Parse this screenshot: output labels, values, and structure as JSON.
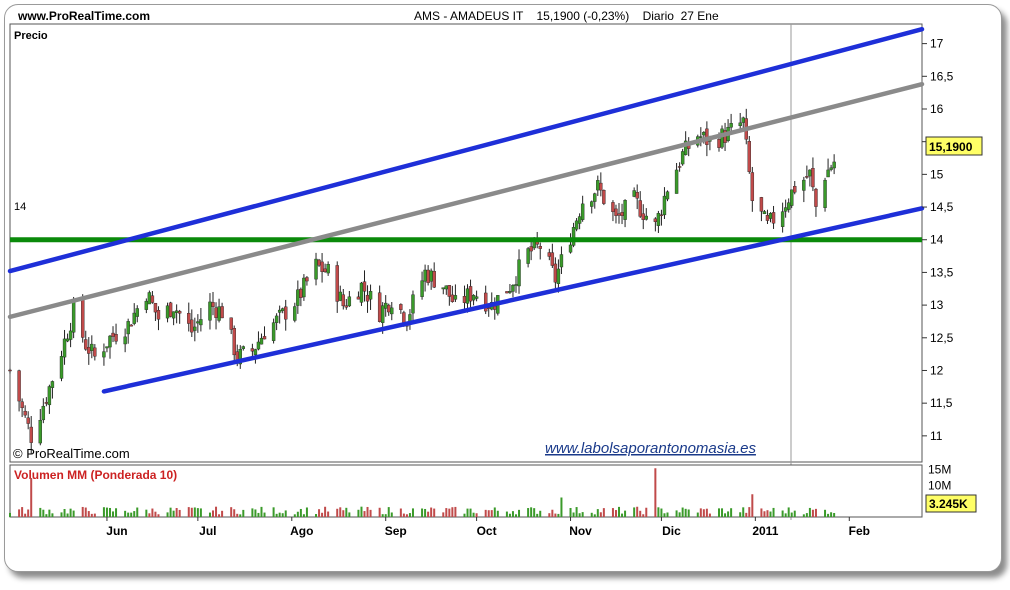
{
  "header": {
    "site": "www.ProRealTime.com",
    "symbol": "AMS - AMADEUS IT",
    "price": "15,1900 (-0,23%)",
    "period": "Diario",
    "date": "27 Ene"
  },
  "colors": {
    "up": "#3a9a2a",
    "down": "#c04a4a",
    "channel": "#1e2fd8",
    "mid_line": "#8a8a8a",
    "support": "#0a8a0a",
    "price_tag": "#ffff66"
  },
  "chart_data": [
    {
      "type": "candlestick",
      "title": "Precio",
      "y_ticks": [
        "17",
        "16,5",
        "16",
        "15,5",
        "15",
        "14,5",
        "14",
        "13,5",
        "13",
        "12,5",
        "12",
        "11,5",
        "11"
      ],
      "y_tick_values": [
        17,
        16.5,
        16,
        15.5,
        15,
        14.5,
        14,
        13.5,
        13,
        12.5,
        12,
        11.5,
        11
      ],
      "ylim": [
        10.6,
        17.3
      ],
      "x_ticks": [
        "Jun",
        "Jul",
        "Ago",
        "Sep",
        "Oct",
        "Nov",
        "Dic",
        "2011",
        "Feb"
      ],
      "last_price": "15,1900",
      "support_label": "14",
      "support_level": 14,
      "trend_lines": [
        {
          "name": "upper-channel",
          "from": [
            "2010-04-30",
            13.52
          ],
          "to": [
            "2011-02-25",
            17.22
          ]
        },
        {
          "name": "mid-channel",
          "from": [
            "2010-04-30",
            12.82
          ],
          "to": [
            "2011-02-25",
            16.38
          ]
        },
        {
          "name": "lower-channel",
          "from": [
            "2010-05-31",
            11.68
          ],
          "to": [
            "2011-02-25",
            14.48
          ]
        }
      ],
      "x_start": "2010-04-30",
      "x_end": "2011-02-25",
      "watermark_top": "© ProRealTime.com",
      "watermark_url": "www.labolsaporantonomasia.es",
      "anchors": [
        [
          "2010-04-30",
          12.0
        ],
        [
          "2010-05-04",
          11.4
        ],
        [
          "2010-05-07",
          11.0
        ],
        [
          "2010-05-12",
          11.6
        ],
        [
          "2010-05-17",
          12.3
        ],
        [
          "2010-05-21",
          12.9
        ],
        [
          "2010-05-25",
          12.4
        ],
        [
          "2010-05-28",
          12.2
        ],
        [
          "2010-06-02",
          12.5
        ],
        [
          "2010-06-08",
          12.7
        ],
        [
          "2010-06-14",
          13.2
        ],
        [
          "2010-06-18",
          12.8
        ],
        [
          "2010-06-23",
          13.0
        ],
        [
          "2010-06-29",
          12.6
        ],
        [
          "2010-07-05",
          13.0
        ],
        [
          "2010-07-09",
          12.9
        ],
        [
          "2010-07-14",
          12.2
        ],
        [
          "2010-07-19",
          12.3
        ],
        [
          "2010-07-23",
          12.6
        ],
        [
          "2010-07-28",
          12.8
        ],
        [
          "2010-08-03",
          13.1
        ],
        [
          "2010-08-09",
          13.6
        ],
        [
          "2010-08-13",
          13.5
        ],
        [
          "2010-08-18",
          13.0
        ],
        [
          "2010-08-24",
          13.3
        ],
        [
          "2010-08-30",
          12.9
        ],
        [
          "2010-09-03",
          13.1
        ],
        [
          "2010-09-08",
          12.8
        ],
        [
          "2010-09-14",
          13.5
        ],
        [
          "2010-09-20",
          13.3
        ],
        [
          "2010-09-24",
          13.0
        ],
        [
          "2010-09-30",
          13.2
        ],
        [
          "2010-10-06",
          13.0
        ],
        [
          "2010-10-12",
          13.3
        ],
        [
          "2010-10-18",
          13.8
        ],
        [
          "2010-10-22",
          13.9
        ],
        [
          "2010-10-27",
          13.4
        ],
        [
          "2010-11-02",
          14.2
        ],
        [
          "2010-11-05",
          14.6
        ],
        [
          "2010-11-10",
          14.8
        ],
        [
          "2010-11-16",
          14.3
        ],
        [
          "2010-11-22",
          14.6
        ],
        [
          "2010-11-29",
          14.2
        ],
        [
          "2010-12-03",
          14.8
        ],
        [
          "2010-12-08",
          15.3
        ],
        [
          "2010-12-13",
          15.6
        ],
        [
          "2010-12-17",
          15.5
        ],
        [
          "2010-12-22",
          15.6
        ],
        [
          "2010-12-28",
          15.8
        ],
        [
          "2010-12-31",
          14.6
        ],
        [
          "2011-01-05",
          14.2
        ],
        [
          "2011-01-10",
          14.5
        ],
        [
          "2011-01-14",
          14.8
        ],
        [
          "2011-01-19",
          15.0
        ],
        [
          "2011-01-21",
          14.5
        ],
        [
          "2011-01-24",
          15.0
        ],
        [
          "2011-01-27",
          15.19
        ]
      ]
    },
    {
      "type": "bar",
      "title": "Volumen",
      "indicator": "MM (Ponderada 10)",
      "y_ticks": [
        "15M",
        "10M"
      ],
      "y_tick_values": [
        15,
        10
      ],
      "ylim": [
        0,
        16
      ],
      "last_value": "3.245K",
      "spikes": [
        [
          "2010-05-07",
          12.0
        ],
        [
          "2010-10-29",
          6.0
        ],
        [
          "2010-11-29",
          15.0
        ],
        [
          "2010-12-31",
          7.0
        ]
      ]
    }
  ]
}
